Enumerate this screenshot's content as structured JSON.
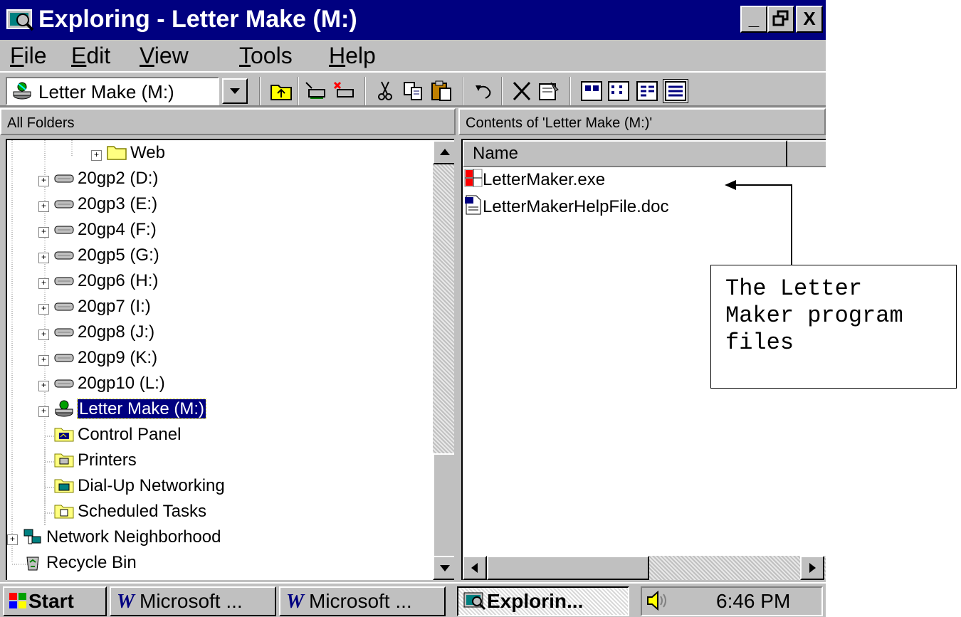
{
  "window": {
    "title": "Exploring - Letter Make (M:)",
    "minimize_glyph": "_",
    "restore_glyph": "Θ",
    "close_glyph": "X"
  },
  "menu": {
    "items": [
      {
        "accel": "F",
        "rest": "ile"
      },
      {
        "accel": "E",
        "rest": "dit"
      },
      {
        "accel": "V",
        "rest": "iew"
      },
      {
        "accel": "T",
        "rest": "ools"
      },
      {
        "accel": "H",
        "rest": "elp"
      }
    ]
  },
  "toolbar": {
    "address_value": "Letter Make (M:)"
  },
  "left_pane": {
    "header": "All Folders",
    "items": [
      {
        "label": "Web",
        "icon": "folder-icon"
      },
      {
        "label": "20gp2 (D:)",
        "icon": "network-drive-icon"
      },
      {
        "label": "20gp3 (E:)",
        "icon": "network-drive-icon"
      },
      {
        "label": "20gp4 (F:)",
        "icon": "network-drive-icon"
      },
      {
        "label": "20gp5 (G:)",
        "icon": "network-drive-icon"
      },
      {
        "label": "20gp6 (H:)",
        "icon": "network-drive-icon"
      },
      {
        "label": "20gp7 (I:)",
        "icon": "network-drive-icon"
      },
      {
        "label": "20gp8 (J:)",
        "icon": "network-drive-icon"
      },
      {
        "label": "20gp9 (K:)",
        "icon": "network-drive-icon"
      },
      {
        "label": "20gp10 (L:)",
        "icon": "network-drive-icon"
      },
      {
        "label": "Letter Make (M:)",
        "icon": "mapped-drive-icon",
        "selected": true
      },
      {
        "label": "Control Panel",
        "icon": "control-panel-icon"
      },
      {
        "label": "Printers",
        "icon": "printers-icon"
      },
      {
        "label": "Dial-Up Networking",
        "icon": "dialup-icon"
      },
      {
        "label": "Scheduled Tasks",
        "icon": "scheduled-tasks-icon"
      },
      {
        "label": "Network Neighborhood",
        "icon": "network-neighborhood-icon"
      },
      {
        "label": "Recycle Bin",
        "icon": "recycle-bin-icon"
      }
    ]
  },
  "right_pane": {
    "header": "Contents of 'Letter Make (M:)'",
    "column_name": "Name",
    "files": [
      {
        "name": "LetterMaker.exe",
        "icon": "exe-icon"
      },
      {
        "name": "LetterMakerHelpFile.doc",
        "icon": "word-doc-icon"
      }
    ]
  },
  "taskbar": {
    "start_label": "Start",
    "tasks": [
      {
        "label": "Microsoft ...",
        "icon": "word-icon"
      },
      {
        "label": "Microsoft ...",
        "icon": "word-icon"
      },
      {
        "label": "Explorin...",
        "icon": "explorer-icon",
        "active": true
      }
    ],
    "clock": "6:46 PM"
  },
  "annotation": {
    "callout_text": "The Letter\nMaker program\nfiles"
  }
}
